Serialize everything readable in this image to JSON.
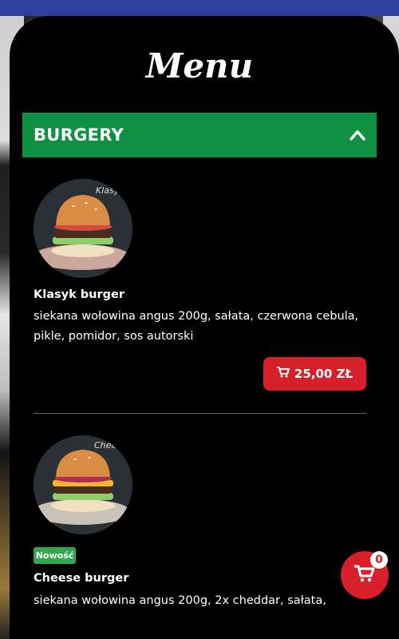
{
  "header": {
    "title": "Menu"
  },
  "category": {
    "label": "BURGERY",
    "icon": "chevron-up-icon",
    "color": "#0e9140"
  },
  "items": [
    {
      "name": "Klasyk burger",
      "photo_label": "Klasyk",
      "desc_line1": "siekana wołowina angus 200g, sałata, czerwona cebula,",
      "desc_line2": "pikle, pomidor, sos autorski",
      "price": "25,00 ZŁ"
    },
    {
      "name": "Cheese burger",
      "photo_label": "Cheese",
      "badge": "Nowość",
      "desc_line1": "siekana wołowina angus 200g, 2x cheddar, sałata,"
    }
  ],
  "cart": {
    "count": "0",
    "icon": "cart-icon",
    "color": "#d8202a"
  }
}
